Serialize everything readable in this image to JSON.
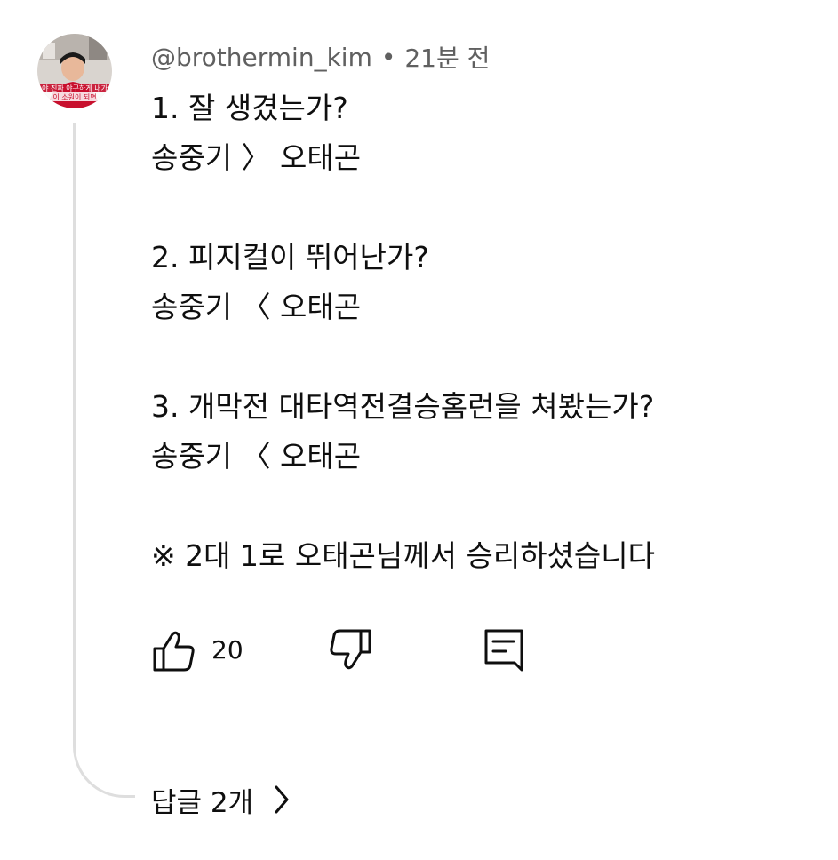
{
  "comment": {
    "author": "@brothermin_kim",
    "separator": "•",
    "time": "21분 전",
    "lines": [
      "1. 잘 생겼는가?",
      "송중기 〉 오태곤",
      "",
      "2. 피지컬이 뛰어난가?",
      "송중기 〈 오태곤",
      "",
      "3. 개막전 대타역전결승홈런을 쳐봤는가?",
      "송중기 〈 오태곤",
      "",
      "※ 2대 1로 오태곤님께서 승리하셨습니다"
    ]
  },
  "actions": {
    "like_icon": "thumbs-up-icon",
    "like_count": "20",
    "dislike_icon": "thumbs-down-icon",
    "reply_icon": "comment-reply-icon"
  },
  "replies": {
    "label": "답글 2개",
    "icon": "chevron-right-icon"
  },
  "avatar": {
    "overlay_text_top": "야 진짜 야구하게 내가",
    "overlay_text_bottom": "이 소원이 되면"
  },
  "colors": {
    "text_primary": "#0f0f0f",
    "text_secondary": "#606060",
    "thread_line": "#dedede",
    "avatar_red": "#c8102e"
  }
}
